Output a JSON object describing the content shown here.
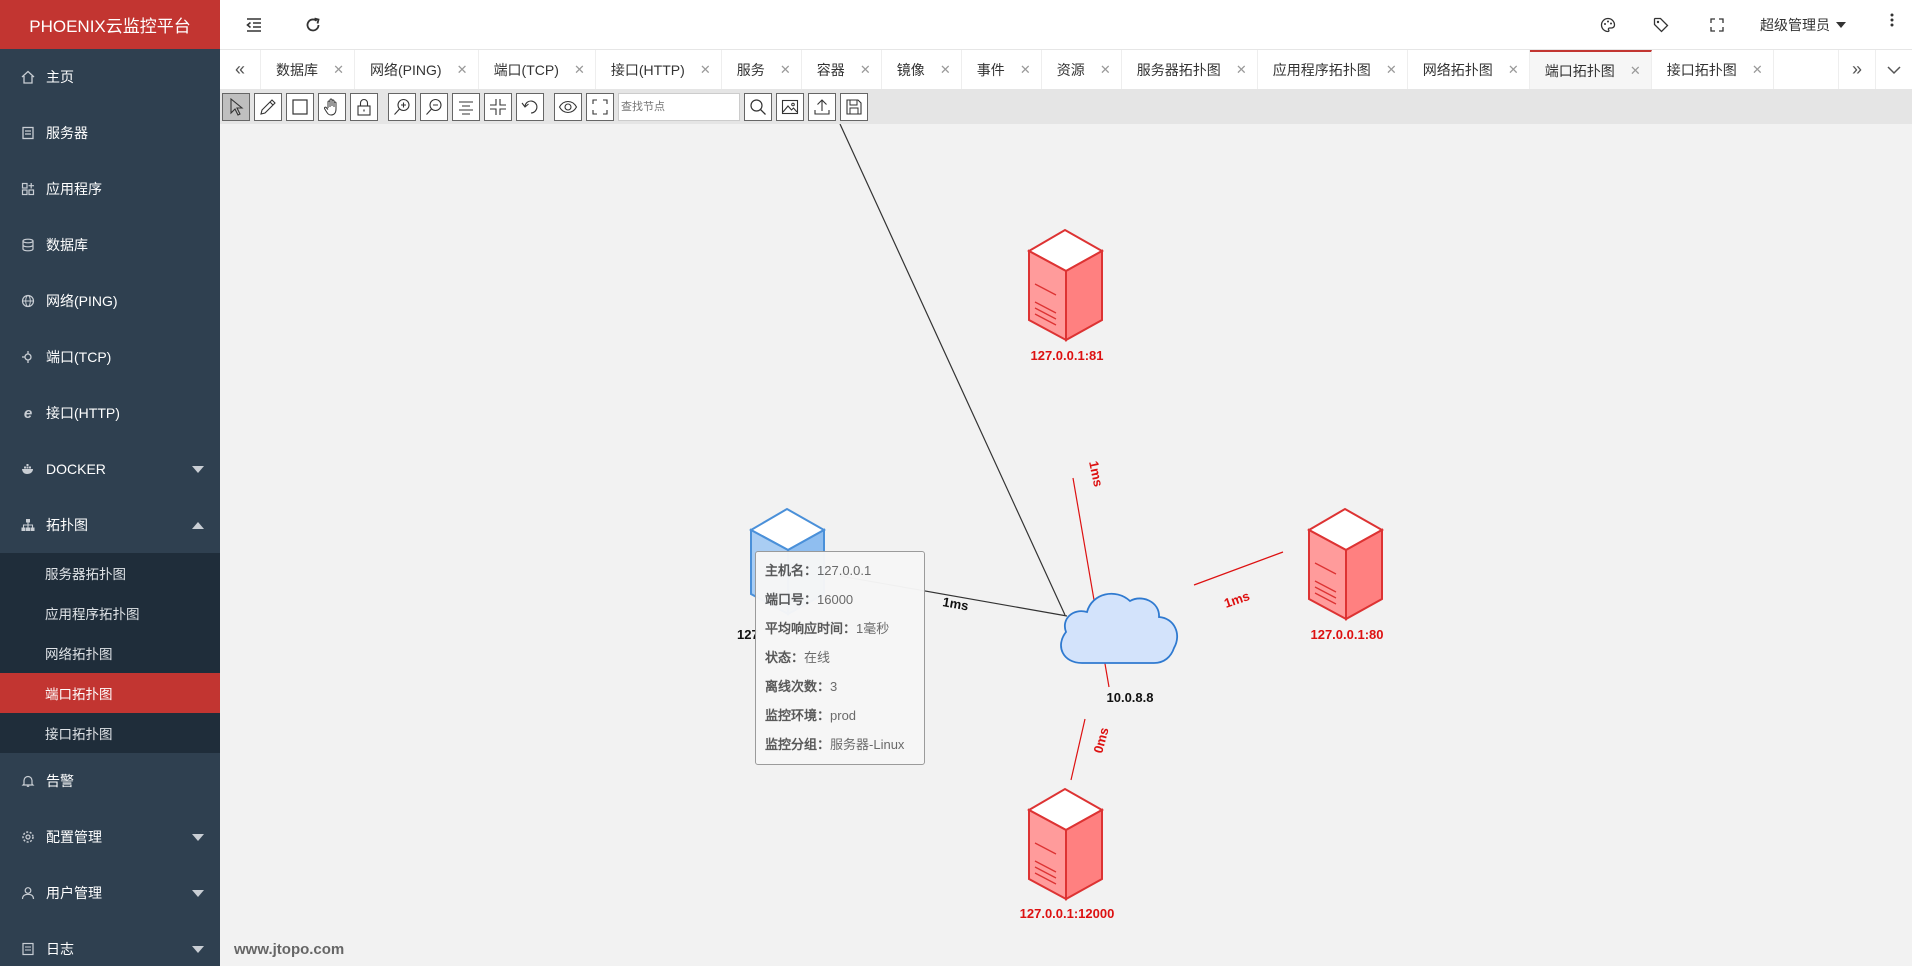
{
  "app": {
    "title": "PHOENIX云监控平台"
  },
  "sidebar": {
    "items": [
      {
        "label": "主页",
        "icon": "home-icon"
      },
      {
        "label": "服务器",
        "icon": "server-icon"
      },
      {
        "label": "应用程序",
        "icon": "apps-icon"
      },
      {
        "label": "数据库",
        "icon": "database-icon"
      },
      {
        "label": "网络(PING)",
        "icon": "globe-icon"
      },
      {
        "label": "端口(TCP)",
        "icon": "port-icon"
      },
      {
        "label": "接口(HTTP)",
        "icon": "ie-icon"
      },
      {
        "label": "DOCKER",
        "icon": "docker-icon"
      },
      {
        "label": "拓扑图",
        "icon": "sitemap-icon"
      }
    ],
    "topology_sub": [
      {
        "label": "服务器拓扑图"
      },
      {
        "label": "应用程序拓扑图"
      },
      {
        "label": "网络拓扑图"
      },
      {
        "label": "端口拓扑图"
      },
      {
        "label": "接口拓扑图"
      }
    ],
    "bottom_items": [
      {
        "label": "告警",
        "icon": "bell-icon"
      },
      {
        "label": "配置管理",
        "icon": "gear-icon"
      },
      {
        "label": "用户管理",
        "icon": "user-icon"
      },
      {
        "label": "日志",
        "icon": "log-icon"
      }
    ]
  },
  "header": {
    "user": "超级管理员"
  },
  "tabs": [
    {
      "label": "数据库"
    },
    {
      "label": "网络(PING)"
    },
    {
      "label": "端口(TCP)"
    },
    {
      "label": "接口(HTTP)"
    },
    {
      "label": "服务"
    },
    {
      "label": "容器"
    },
    {
      "label": "镜像"
    },
    {
      "label": "事件"
    },
    {
      "label": "资源"
    },
    {
      "label": "服务器拓扑图"
    },
    {
      "label": "应用程序拓扑图"
    },
    {
      "label": "网络拓扑图"
    },
    {
      "label": "端口拓扑图",
      "active": true
    },
    {
      "label": "接口拓扑图"
    }
  ],
  "toolbar": {
    "search_placeholder": "查找节点"
  },
  "topology": {
    "center": {
      "label": "10.0.8.8"
    },
    "nodes": [
      {
        "label": "127.0.0.1:81",
        "status": "offline",
        "latency": "1ms"
      },
      {
        "label": "127.0.0.1:80",
        "status": "offline",
        "latency": "1ms"
      },
      {
        "label": "127.0.0.1:12000",
        "status": "offline",
        "latency": "0ms"
      },
      {
        "label": "127",
        "status": "online",
        "latency": "1ms"
      }
    ],
    "colors": {
      "offline": "#dd1111",
      "online_line": "#333333",
      "server_red": "#ff9b9b",
      "server_blue": "#a9cdf3",
      "cloud": "#d3e3fb"
    },
    "watermark": "www.jtopo.com"
  },
  "tooltip": {
    "rows": [
      {
        "key": "主机名：",
        "value": "127.0.0.1"
      },
      {
        "key": "端口号：",
        "value": "16000"
      },
      {
        "key": "平均响应时间：",
        "value": "1毫秒"
      },
      {
        "key": "状态：",
        "value": "在线"
      },
      {
        "key": "离线次数：",
        "value": "3"
      },
      {
        "key": "监控环境：",
        "value": "prod"
      },
      {
        "key": "监控分组：",
        "value": "服务器-Linux"
      }
    ]
  }
}
